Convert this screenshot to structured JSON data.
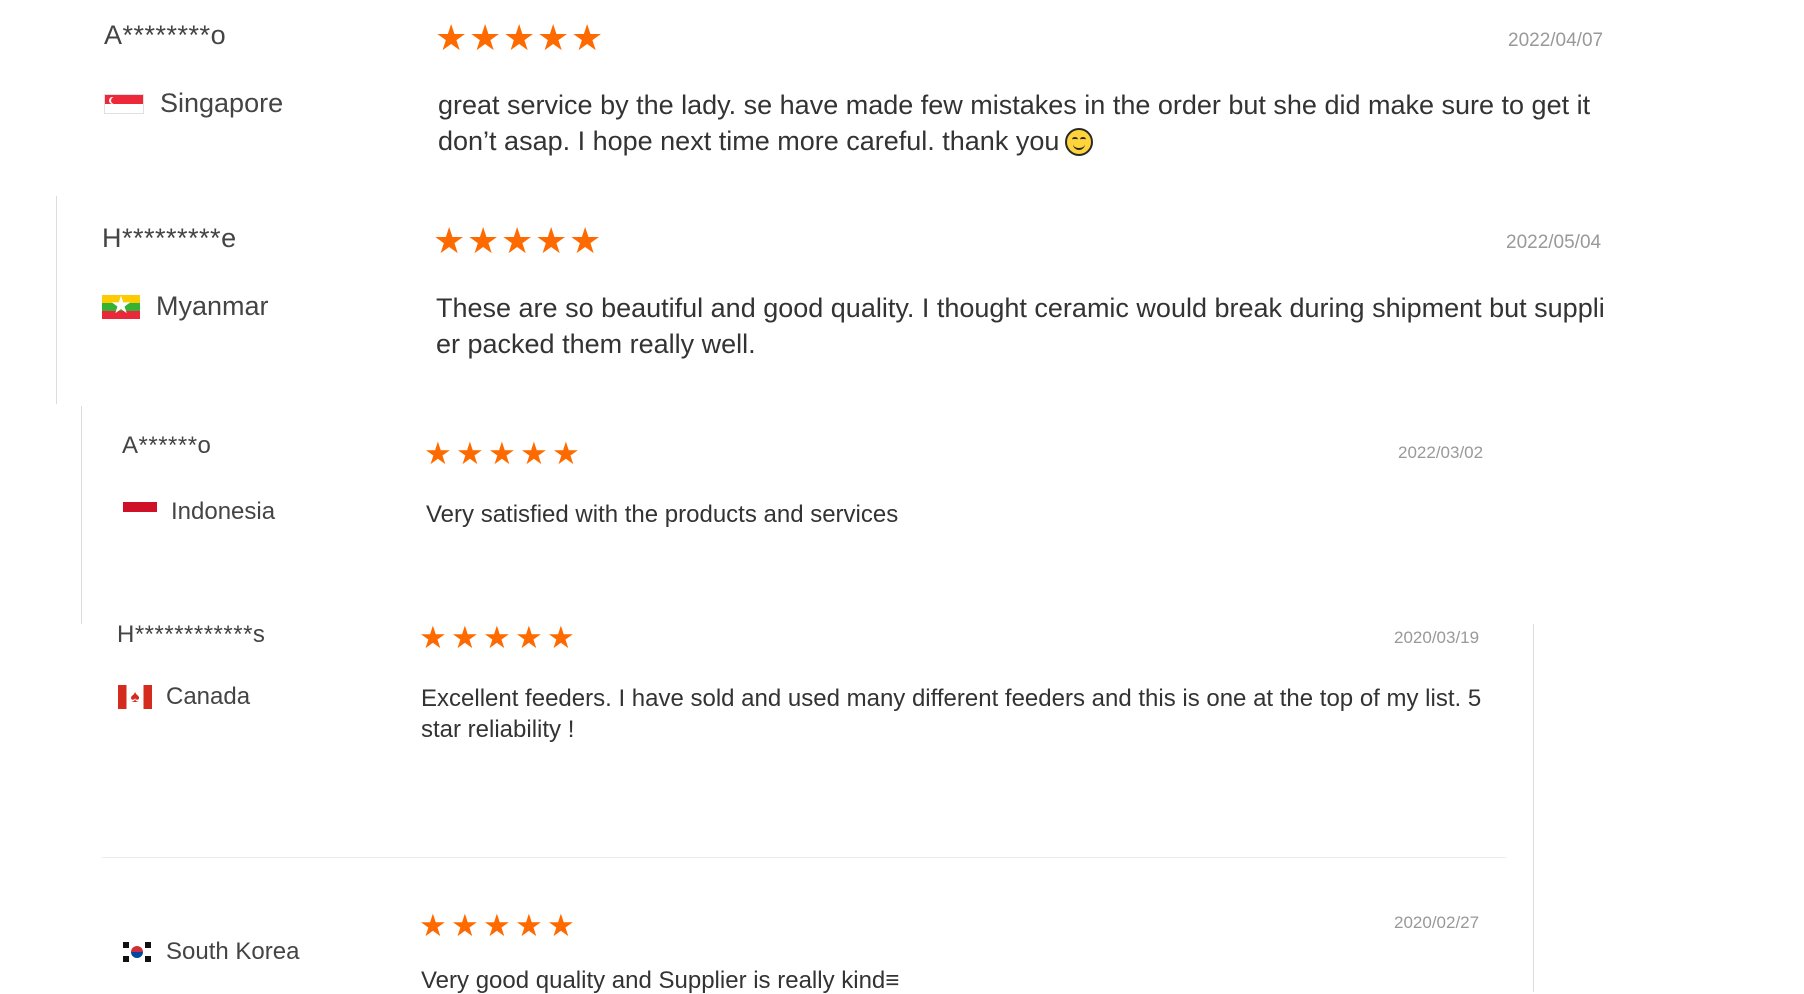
{
  "reviews": [
    {
      "name": "A********o",
      "country": "Singapore",
      "flag_icon": "singapore-flag-icon",
      "rating": 5,
      "stars": [
        "★",
        "★",
        "★",
        "★",
        "★"
      ],
      "date": "2022/04/07",
      "comment": "great service by the lady. se have made few mistakes in the order but she did make sure to get it don’t asap. I hope next time more careful. thank you",
      "emoji": "smiling-face-icon"
    },
    {
      "name": "H*********e",
      "country": "Myanmar",
      "flag_icon": "myanmar-flag-icon",
      "rating": 5,
      "stars": [
        "★",
        "★",
        "★",
        "★",
        "★"
      ],
      "date": "2022/05/04",
      "comment": "These are so beautiful and good quality. I thought ceramic would break during shipment but supplier packed them really well."
    },
    {
      "name": "A******o",
      "country": "Indonesia",
      "flag_icon": "indonesia-flag-icon",
      "rating": 5,
      "stars": [
        "★",
        "★",
        "★",
        "★",
        "★"
      ],
      "date": "2022/03/02",
      "comment": "Very satisfied with the products and services"
    },
    {
      "name": "H************s",
      "country": "Canada",
      "flag_icon": "canada-flag-icon",
      "rating": 5,
      "stars": [
        "★",
        "★",
        "★",
        "★",
        "★"
      ],
      "date": "2020/03/19",
      "comment": "Excellent feeders. I have sold and used many different feeders and this is one at the top of my list. 5 star reliability !"
    },
    {
      "name": "",
      "country": "South Korea",
      "flag_icon": "south-korea-flag-icon",
      "rating": 5,
      "stars": [
        "★",
        "★",
        "★",
        "★",
        "★"
      ],
      "date": "2020/02/27",
      "comment": "Very good quality and Supplier is really kind≡"
    }
  ],
  "colors": {
    "star": "#ff6a00",
    "date": "#999999",
    "text": "#333333",
    "divider": "#ececec"
  }
}
